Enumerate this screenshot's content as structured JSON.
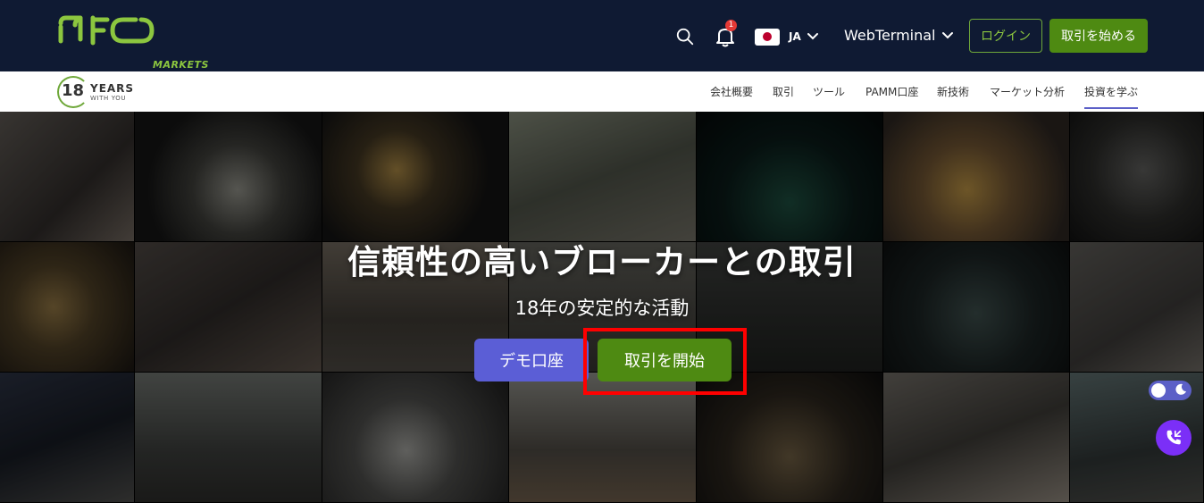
{
  "header": {
    "logo_text": "IFC",
    "logo_sub": "MARKETS",
    "notification_count": "1",
    "language_code": "JA",
    "webterminal_label": "WebTerminal",
    "login_label": "ログイン",
    "start_trading_label": "取引を始める"
  },
  "anniversary": {
    "number": "18",
    "line1": "YEARS",
    "line2": "WITH YOU"
  },
  "nav": {
    "items": [
      {
        "label": "会社概要"
      },
      {
        "label": "取引"
      },
      {
        "label": "ツール"
      },
      {
        "label": "PAMM口座"
      },
      {
        "label": "新技術"
      },
      {
        "label": "マーケット分析"
      },
      {
        "label": "投資を学ぶ",
        "active": true
      }
    ]
  },
  "hero": {
    "title": "信頼性の高いブローカーとの取引",
    "subtitle": "18年の安定的な活動",
    "demo_label": "デモ口座",
    "start_label": "取引を開始"
  },
  "colors": {
    "header_bg": "#0f1a33",
    "brand_green": "#8cc63f",
    "button_green": "#4e8a12",
    "demo_purple": "#5b5ed6",
    "highlight": "#ff0000"
  }
}
